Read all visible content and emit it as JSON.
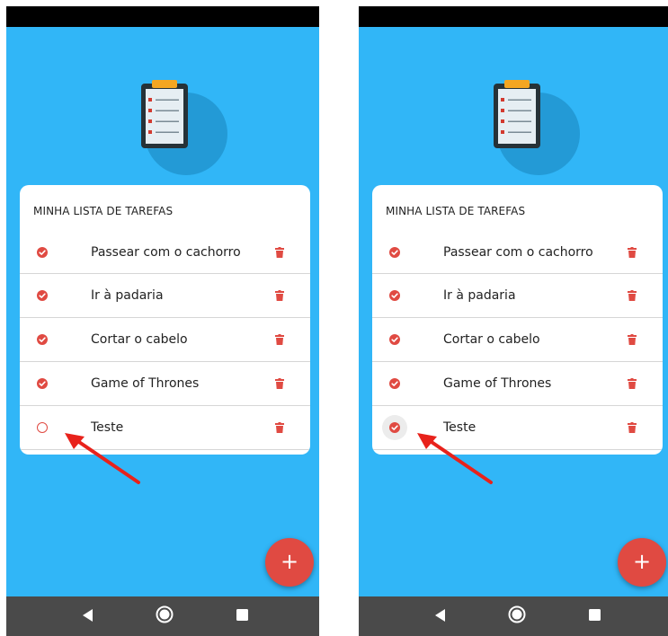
{
  "screens": [
    {
      "list_title": "MINHA LISTA DE TAREFAS",
      "tasks": [
        {
          "label": "Passear com o cachorro",
          "done": true
        },
        {
          "label": "Ir à padaria",
          "done": true
        },
        {
          "label": "Cortar o cabelo",
          "done": true
        },
        {
          "label": "Game of Thrones",
          "done": true
        },
        {
          "label": "Teste",
          "done": false
        }
      ],
      "fab_label": "+"
    },
    {
      "list_title": "MINHA LISTA DE TAREFAS",
      "tasks": [
        {
          "label": "Passear com o cachorro",
          "done": true
        },
        {
          "label": "Ir à padaria",
          "done": true
        },
        {
          "label": "Cortar o cabelo",
          "done": true
        },
        {
          "label": "Game of Thrones",
          "done": true
        },
        {
          "label": "Teste",
          "done": true
        }
      ],
      "fab_label": "+"
    }
  ],
  "icons": {
    "logo": "clipboard-icon",
    "check": "check-circle-icon",
    "check_empty": "empty-circle-icon",
    "delete": "trash-icon",
    "fab": "plus-icon",
    "nav_back": "back-triangle-icon",
    "nav_home": "home-circle-icon",
    "nav_recents": "recents-square-icon",
    "annotation": "red-arrow"
  },
  "colors": {
    "background": "#31b6f7",
    "accent": "#e04a42",
    "clipboard": "#263238",
    "clip": "#f4a621",
    "annotation_arrow": "#e8221b",
    "nav_bar": "#4a4a4a"
  }
}
